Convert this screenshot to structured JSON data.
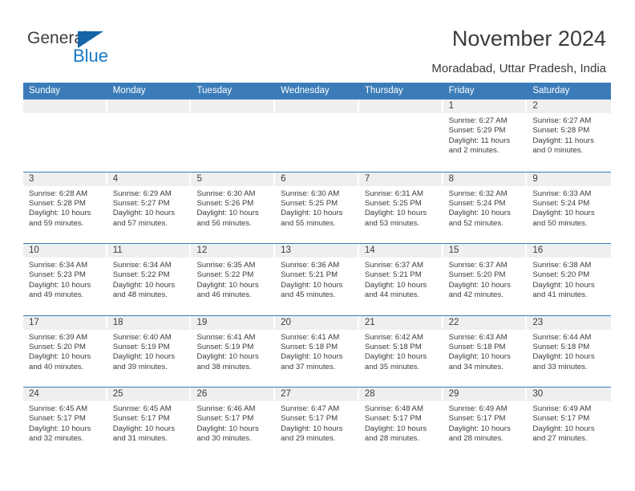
{
  "brand": {
    "name_part1": "General",
    "name_part2": "Blue",
    "triangle_icon": "blue-triangle-icon",
    "colors": {
      "dark": "#3c3c3c",
      "blue": "#1579c4",
      "triangle": "#1565a8"
    }
  },
  "header": {
    "title": "November 2024",
    "subtitle": "Moradabad, Uttar Pradesh, India"
  },
  "theme": {
    "header_blue": "#3b7cb8",
    "daybar_gray": "#efefef",
    "text": "#3c3c3c",
    "cell_bg": "#ffffff"
  },
  "calendar": {
    "weekdays": [
      "Sunday",
      "Monday",
      "Tuesday",
      "Wednesday",
      "Thursday",
      "Friday",
      "Saturday"
    ],
    "weeks": [
      [
        {
          "day": "",
          "sunrise": "",
          "sunset": "",
          "daylight_line1": "",
          "daylight_line2": ""
        },
        {
          "day": "",
          "sunrise": "",
          "sunset": "",
          "daylight_line1": "",
          "daylight_line2": ""
        },
        {
          "day": "",
          "sunrise": "",
          "sunset": "",
          "daylight_line1": "",
          "daylight_line2": ""
        },
        {
          "day": "",
          "sunrise": "",
          "sunset": "",
          "daylight_line1": "",
          "daylight_line2": ""
        },
        {
          "day": "",
          "sunrise": "",
          "sunset": "",
          "daylight_line1": "",
          "daylight_line2": ""
        },
        {
          "day": "1",
          "sunrise": "Sunrise: 6:27 AM",
          "sunset": "Sunset: 5:29 PM",
          "daylight_line1": "Daylight: 11 hours",
          "daylight_line2": "and 2 minutes."
        },
        {
          "day": "2",
          "sunrise": "Sunrise: 6:27 AM",
          "sunset": "Sunset: 5:28 PM",
          "daylight_line1": "Daylight: 11 hours",
          "daylight_line2": "and 0 minutes."
        }
      ],
      [
        {
          "day": "3",
          "sunrise": "Sunrise: 6:28 AM",
          "sunset": "Sunset: 5:28 PM",
          "daylight_line1": "Daylight: 10 hours",
          "daylight_line2": "and 59 minutes."
        },
        {
          "day": "4",
          "sunrise": "Sunrise: 6:29 AM",
          "sunset": "Sunset: 5:27 PM",
          "daylight_line1": "Daylight: 10 hours",
          "daylight_line2": "and 57 minutes."
        },
        {
          "day": "5",
          "sunrise": "Sunrise: 6:30 AM",
          "sunset": "Sunset: 5:26 PM",
          "daylight_line1": "Daylight: 10 hours",
          "daylight_line2": "and 56 minutes."
        },
        {
          "day": "6",
          "sunrise": "Sunrise: 6:30 AM",
          "sunset": "Sunset: 5:25 PM",
          "daylight_line1": "Daylight: 10 hours",
          "daylight_line2": "and 55 minutes."
        },
        {
          "day": "7",
          "sunrise": "Sunrise: 6:31 AM",
          "sunset": "Sunset: 5:25 PM",
          "daylight_line1": "Daylight: 10 hours",
          "daylight_line2": "and 53 minutes."
        },
        {
          "day": "8",
          "sunrise": "Sunrise: 6:32 AM",
          "sunset": "Sunset: 5:24 PM",
          "daylight_line1": "Daylight: 10 hours",
          "daylight_line2": "and 52 minutes."
        },
        {
          "day": "9",
          "sunrise": "Sunrise: 6:33 AM",
          "sunset": "Sunset: 5:24 PM",
          "daylight_line1": "Daylight: 10 hours",
          "daylight_line2": "and 50 minutes."
        }
      ],
      [
        {
          "day": "10",
          "sunrise": "Sunrise: 6:34 AM",
          "sunset": "Sunset: 5:23 PM",
          "daylight_line1": "Daylight: 10 hours",
          "daylight_line2": "and 49 minutes."
        },
        {
          "day": "11",
          "sunrise": "Sunrise: 6:34 AM",
          "sunset": "Sunset: 5:22 PM",
          "daylight_line1": "Daylight: 10 hours",
          "daylight_line2": "and 48 minutes."
        },
        {
          "day": "12",
          "sunrise": "Sunrise: 6:35 AM",
          "sunset": "Sunset: 5:22 PM",
          "daylight_line1": "Daylight: 10 hours",
          "daylight_line2": "and 46 minutes."
        },
        {
          "day": "13",
          "sunrise": "Sunrise: 6:36 AM",
          "sunset": "Sunset: 5:21 PM",
          "daylight_line1": "Daylight: 10 hours",
          "daylight_line2": "and 45 minutes."
        },
        {
          "day": "14",
          "sunrise": "Sunrise: 6:37 AM",
          "sunset": "Sunset: 5:21 PM",
          "daylight_line1": "Daylight: 10 hours",
          "daylight_line2": "and 44 minutes."
        },
        {
          "day": "15",
          "sunrise": "Sunrise: 6:37 AM",
          "sunset": "Sunset: 5:20 PM",
          "daylight_line1": "Daylight: 10 hours",
          "daylight_line2": "and 42 minutes."
        },
        {
          "day": "16",
          "sunrise": "Sunrise: 6:38 AM",
          "sunset": "Sunset: 5:20 PM",
          "daylight_line1": "Daylight: 10 hours",
          "daylight_line2": "and 41 minutes."
        }
      ],
      [
        {
          "day": "17",
          "sunrise": "Sunrise: 6:39 AM",
          "sunset": "Sunset: 5:20 PM",
          "daylight_line1": "Daylight: 10 hours",
          "daylight_line2": "and 40 minutes."
        },
        {
          "day": "18",
          "sunrise": "Sunrise: 6:40 AM",
          "sunset": "Sunset: 5:19 PM",
          "daylight_line1": "Daylight: 10 hours",
          "daylight_line2": "and 39 minutes."
        },
        {
          "day": "19",
          "sunrise": "Sunrise: 6:41 AM",
          "sunset": "Sunset: 5:19 PM",
          "daylight_line1": "Daylight: 10 hours",
          "daylight_line2": "and 38 minutes."
        },
        {
          "day": "20",
          "sunrise": "Sunrise: 6:41 AM",
          "sunset": "Sunset: 5:18 PM",
          "daylight_line1": "Daylight: 10 hours",
          "daylight_line2": "and 37 minutes."
        },
        {
          "day": "21",
          "sunrise": "Sunrise: 6:42 AM",
          "sunset": "Sunset: 5:18 PM",
          "daylight_line1": "Daylight: 10 hours",
          "daylight_line2": "and 35 minutes."
        },
        {
          "day": "22",
          "sunrise": "Sunrise: 6:43 AM",
          "sunset": "Sunset: 5:18 PM",
          "daylight_line1": "Daylight: 10 hours",
          "daylight_line2": "and 34 minutes."
        },
        {
          "day": "23",
          "sunrise": "Sunrise: 6:44 AM",
          "sunset": "Sunset: 5:18 PM",
          "daylight_line1": "Daylight: 10 hours",
          "daylight_line2": "and 33 minutes."
        }
      ],
      [
        {
          "day": "24",
          "sunrise": "Sunrise: 6:45 AM",
          "sunset": "Sunset: 5:17 PM",
          "daylight_line1": "Daylight: 10 hours",
          "daylight_line2": "and 32 minutes."
        },
        {
          "day": "25",
          "sunrise": "Sunrise: 6:45 AM",
          "sunset": "Sunset: 5:17 PM",
          "daylight_line1": "Daylight: 10 hours",
          "daylight_line2": "and 31 minutes."
        },
        {
          "day": "26",
          "sunrise": "Sunrise: 6:46 AM",
          "sunset": "Sunset: 5:17 PM",
          "daylight_line1": "Daylight: 10 hours",
          "daylight_line2": "and 30 minutes."
        },
        {
          "day": "27",
          "sunrise": "Sunrise: 6:47 AM",
          "sunset": "Sunset: 5:17 PM",
          "daylight_line1": "Daylight: 10 hours",
          "daylight_line2": "and 29 minutes."
        },
        {
          "day": "28",
          "sunrise": "Sunrise: 6:48 AM",
          "sunset": "Sunset: 5:17 PM",
          "daylight_line1": "Daylight: 10 hours",
          "daylight_line2": "and 28 minutes."
        },
        {
          "day": "29",
          "sunrise": "Sunrise: 6:49 AM",
          "sunset": "Sunset: 5:17 PM",
          "daylight_line1": "Daylight: 10 hours",
          "daylight_line2": "and 28 minutes."
        },
        {
          "day": "30",
          "sunrise": "Sunrise: 6:49 AM",
          "sunset": "Sunset: 5:17 PM",
          "daylight_line1": "Daylight: 10 hours",
          "daylight_line2": "and 27 minutes."
        }
      ]
    ]
  }
}
